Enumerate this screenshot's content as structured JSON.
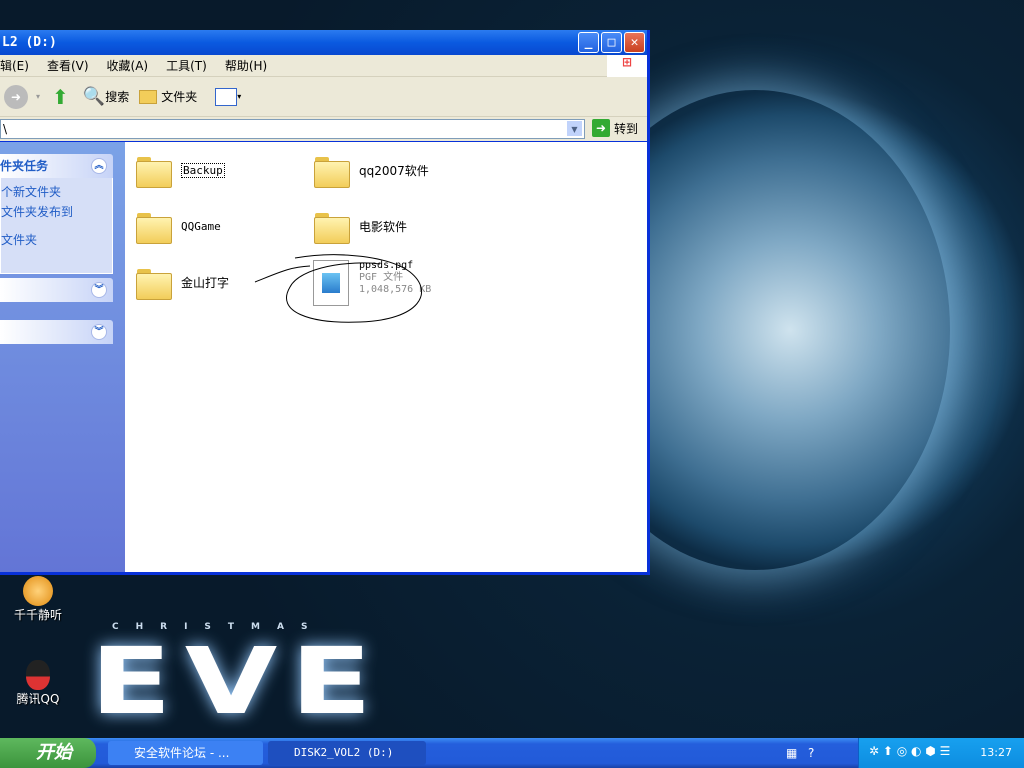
{
  "window": {
    "title": "L2 (D:)",
    "menu": [
      "辑(E)",
      "查看(V)",
      "收藏(A)",
      "工具(T)",
      "帮助(H)"
    ],
    "toolbar": {
      "search": "搜索",
      "folders": "文件夹"
    },
    "address": {
      "value": "\\",
      "go": "转到"
    },
    "tasks": {
      "header": "件夹任务",
      "items": [
        "个新文件夹",
        "文件夹发布到",
        "文件夹"
      ]
    },
    "files": [
      {
        "name": "Backup",
        "type": "folder"
      },
      {
        "name": "qq2007软件",
        "type": "folder"
      },
      {
        "name": "QQGame",
        "type": "folder"
      },
      {
        "name": "电影软件",
        "type": "folder"
      },
      {
        "name": "金山打字",
        "type": "folder"
      },
      {
        "name": "ppsds.pgf",
        "type": "PGF 文件",
        "size": "1,048,576 KB"
      }
    ]
  },
  "desktop": {
    "icons": [
      "千千静听",
      "腾讯QQ"
    ],
    "wallpaper": {
      "subtitle": "CHRISTMAS",
      "logo": "EVE"
    }
  },
  "taskbar": {
    "start": "开始",
    "tasks": [
      "安全软件论坛 - ...",
      "DISK2_VOL2 (D:)"
    ],
    "clock": "13:27"
  }
}
